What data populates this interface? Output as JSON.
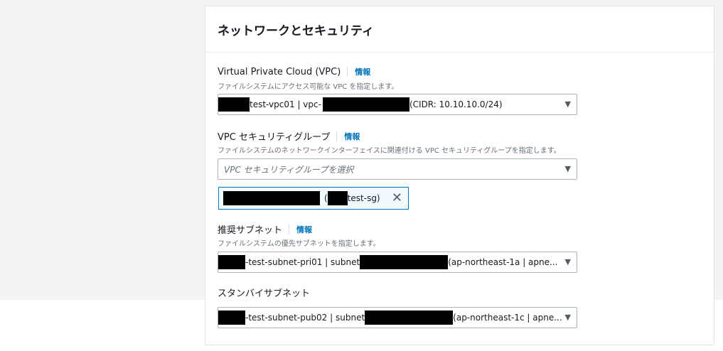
{
  "section": {
    "title": "ネットワークとセキュリティ"
  },
  "vpc": {
    "label": "Virtual Private Cloud (VPC)",
    "info": "情報",
    "description": "ファイルシステムにアクセス可能な VPC を指定します。",
    "value_a": "test-vpc01 | vpc-",
    "value_b": "(CIDR: 10.10.10.0/24)"
  },
  "sg": {
    "label": "VPC セキュリティグループ",
    "info": "情報",
    "description": "ファイルシステムのネットワークインターフェイスに関連付ける VPC セキュリティグループを指定します。",
    "placeholder": "VPC セキュリティグループを選択",
    "token_open": "(",
    "token_name": "test-sg)",
    "token_remove": "✕"
  },
  "preferred_subnet": {
    "label": "推奨サブネット",
    "info": "情報",
    "description": "ファイルシステムの優先サブネットを指定します。",
    "value_a": "-test-subnet-pri01 | subnet",
    "value_b": "(ap-northeast-1a | apne..."
  },
  "standby_subnet": {
    "label": "スタンバイサブネット",
    "value_a": "-test-subnet-pub02 | subnet",
    "value_b": "(ap-northeast-1c | apne..."
  },
  "icons": {
    "caret": "caret-down-icon",
    "remove": "close-icon"
  },
  "colors": {
    "accent": "#0073bb",
    "border": "#aab7b8",
    "background": "#f2f3f3"
  }
}
